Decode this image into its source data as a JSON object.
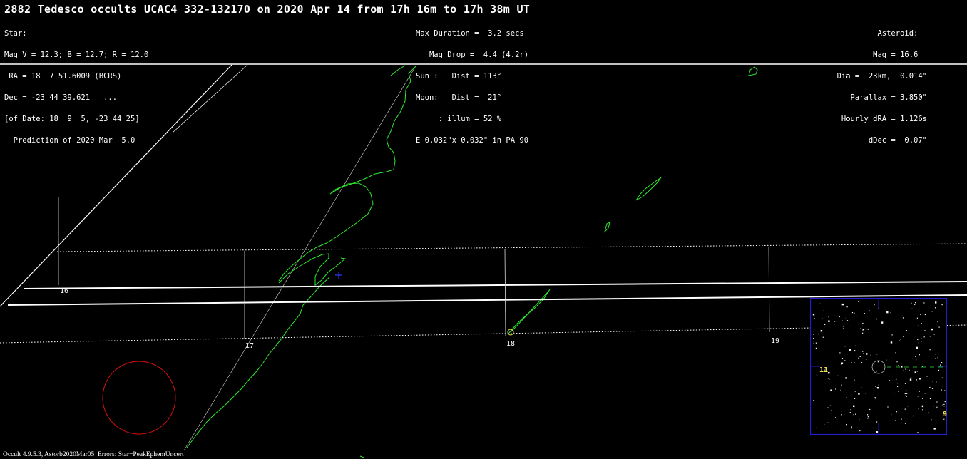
{
  "title": "2882 Tedesco occults UCAC4 332-132170 on 2020 Apr 14 from 17h 16m to 17h 38m UT",
  "star": {
    "lines": [
      "Star:",
      "Mag V = 12.3; B = 12.7; R = 12.0",
      " RA = 18  7 51.6009 (BCRS)",
      "Dec = -23 44 39.621   ...",
      "[of Date: 18  9  5, -23 44 25]",
      "  Prediction of 2020 Mar  5.0"
    ]
  },
  "event": {
    "lines": [
      "Max Duration =  3.2 secs",
      "   Mag Drop =  4.4 (4.2r)",
      "Sun :   Dist = 113°",
      "Moon:   Dist =  21°",
      "     : illum = 52 %",
      "E 0.032\"x 0.032\" in PA 90"
    ]
  },
  "asteroid": {
    "lines": [
      "Asteroid:  ",
      "Mag = 16.6  ",
      "Dia =  23km,  0.014\"",
      "Parallax = 3.850\"",
      "Hourly dRA = 1.126s",
      "dDec =  0.07\""
    ]
  },
  "time_ticks": [
    "16",
    "17",
    "18",
    "19"
  ],
  "inset": {
    "labels": [
      "11",
      "9"
    ],
    "border_color": "#1f1fd0"
  },
  "footer": "Occult 4.9.5.3, Astorb2020Mar05  Errors: Star+PeakEphemUncert",
  "colors": {
    "coastline": "#2ee82e",
    "path_lines": "#ffffff",
    "moon_circle": "#e01010",
    "center_marker": "#2a3cff"
  }
}
